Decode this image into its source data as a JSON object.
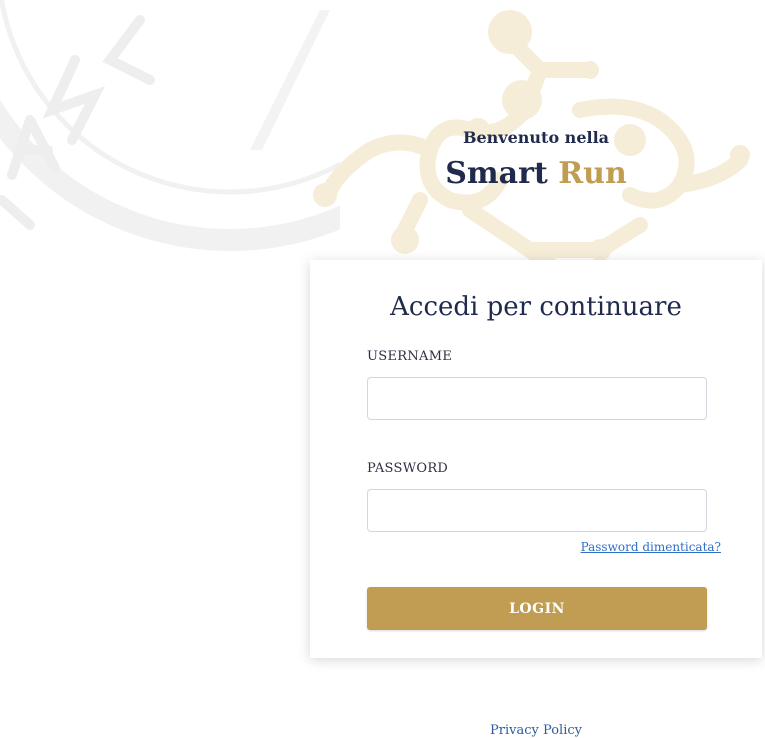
{
  "welcome": {
    "subtitle": "Benvenuto nella",
    "brand_main": "Smart",
    "brand_accent": "Run"
  },
  "login_card": {
    "title": "Accedi per continuare",
    "username_label": "USERNAME",
    "username_value": "",
    "password_label": "PASSWORD",
    "password_value": "",
    "forgot_password": "Password dimenticata?",
    "login_button": "LOGIN"
  },
  "footer": {
    "privacy_policy": "Privacy Policy"
  },
  "colors": {
    "navy": "#1f2a4d",
    "gold": "#c09d52",
    "ornament": "#f6edd8",
    "link": "#2f6fc4"
  },
  "icons": {
    "background_seal": "seal-watermark-icon",
    "background_ornament": "ornament-watermark-icon"
  }
}
